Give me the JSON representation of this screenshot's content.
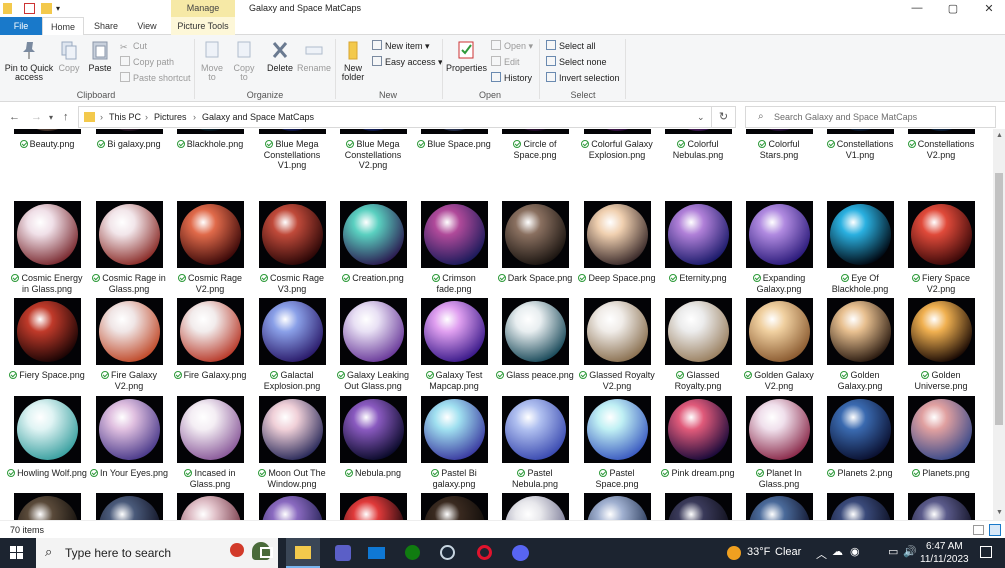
{
  "window": {
    "title": "Galaxy and Space MatCaps",
    "manage_tab": "Manage",
    "minimize": "—",
    "maximize": "▢",
    "close": "✕"
  },
  "ribbon_tabs": {
    "file": "File",
    "home": "Home",
    "share": "Share",
    "view": "View",
    "picture_tools": "Picture Tools"
  },
  "ribbon": {
    "pin_to_quick_access": "Pin to Quick access",
    "copy": "Copy",
    "paste": "Paste",
    "cut": "Cut",
    "copy_path": "Copy path",
    "paste_shortcut": "Paste shortcut",
    "move_to": "Move to",
    "copy_to": "Copy to",
    "delete": "Delete",
    "rename": "Rename",
    "new_folder": "New folder",
    "new_item": "New item",
    "easy_access": "Easy access",
    "properties": "Properties",
    "open": "Open",
    "edit": "Edit",
    "history": "History",
    "select_all": "Select all",
    "select_none": "Select none",
    "invert_selection": "Invert selection",
    "groups": {
      "clipboard": "Clipboard",
      "organize": "Organize",
      "new": "New",
      "open": "Open",
      "select": "Select"
    }
  },
  "address": {
    "root": "This PC",
    "sep": "›",
    "folder1": "Pictures",
    "folder2": "Galaxy and Space MatCaps"
  },
  "search": {
    "placeholder": "Search Galaxy and Space MatCaps"
  },
  "files": [
    {
      "name": "Beauty.png",
      "c1": "#c7b8b0",
      "c2": "#3a2a22"
    },
    {
      "name": "Bi galaxy.png",
      "c1": "#a8708a",
      "c2": "#1c0f1c"
    },
    {
      "name": "Blackhole.png",
      "c1": "#3aa0b0",
      "c2": "#04111a"
    },
    {
      "name": "Blue Mega Constellations V1.png",
      "c1": "#5b78d8",
      "c2": "#0b1040"
    },
    {
      "name": "Blue Mega Constellations V2.png",
      "c1": "#6a8be0",
      "c2": "#0a1244"
    },
    {
      "name": "Blue Space.png",
      "c1": "#a7b5d0",
      "c2": "#1d2540"
    },
    {
      "name": "Circle of Space.png",
      "c1": "#aa5aa0",
      "c2": "#1b0824"
    },
    {
      "name": "Colorful Galaxy Explosion.png",
      "c1": "#d884b4",
      "c2": "#2a0a3a"
    },
    {
      "name": "Colorful Nebulas.png",
      "c1": "#e07a8a",
      "c2": "#30104a"
    },
    {
      "name": "Colorful Stars.png",
      "c1": "#c05080",
      "c2": "#1a0a30"
    },
    {
      "name": "Constellations V1.png",
      "c1": "#3a6fa0",
      "c2": "#061226"
    },
    {
      "name": "Constellations V2.png",
      "c1": "#4a80a8",
      "c2": "#081830"
    },
    {
      "name": "Cosmic Energy in Glass.png",
      "c1": "#f0e0e8",
      "c2": "#7a2a30"
    },
    {
      "name": "Cosmic Rage in Glass.png",
      "c1": "#f2e6ea",
      "c2": "#8a2c28"
    },
    {
      "name": "Cosmic Rage V2.png",
      "c1": "#e06a4a",
      "c2": "#3a0808"
    },
    {
      "name": "Cosmic Rage V3.png",
      "c1": "#c04a3a",
      "c2": "#2a0606"
    },
    {
      "name": "Creation.png",
      "c1": "#5ad0c0",
      "c2": "#2a1a50"
    },
    {
      "name": "Crimson fade.png",
      "c1": "#b04a9a",
      "c2": "#1a1a5a"
    },
    {
      "name": "Dark Space.png",
      "c1": "#8a7060",
      "c2": "#1a1410"
    },
    {
      "name": "Deep Space.png",
      "c1": "#f0d0b0",
      "c2": "#3a2a2a"
    },
    {
      "name": "Eternity.png",
      "c1": "#b080d8",
      "c2": "#1a1a6a"
    },
    {
      "name": "Expanding Galaxy.png",
      "c1": "#b08ae0",
      "c2": "#2a1a7a"
    },
    {
      "name": "Eye Of Blackhole.png",
      "c1": "#2ab0e0",
      "c2": "#000812"
    },
    {
      "name": "Fiery Space V2.png",
      "c1": "#e04a3a",
      "c2": "#3a0808"
    },
    {
      "name": "Fiery Space.png",
      "c1": "#c03a2a",
      "c2": "#1a0404"
    },
    {
      "name": "Fire Galaxy V2.png",
      "c1": "#f0e6e6",
      "c2": "#c04a2a"
    },
    {
      "name": "Fire Galaxy.png",
      "c1": "#f2ecec",
      "c2": "#b83a2a"
    },
    {
      "name": "Galactal Explosion.png",
      "c1": "#8aa0e8",
      "c2": "#2a1a6a"
    },
    {
      "name": "Galaxy Leaking Out Glass.png",
      "c1": "#e8e0f4",
      "c2": "#6a3a9a"
    },
    {
      "name": "Galaxy Test Mapcap.png",
      "c1": "#e0a0f0",
      "c2": "#3a1a8a"
    },
    {
      "name": "Glass peace.png",
      "c1": "#e8eef0",
      "c2": "#1a4a5a"
    },
    {
      "name": "Glassed Royalty V2.png",
      "c1": "#f0ece8",
      "c2": "#8a7050"
    },
    {
      "name": "Glassed Royalty.png",
      "c1": "#ececec",
      "c2": "#9a8060"
    },
    {
      "name": "Golden Galaxy V2.png",
      "c1": "#f0d0a0",
      "c2": "#8a5a30"
    },
    {
      "name": "Golden Galaxy.png",
      "c1": "#e8c090",
      "c2": "#2a1a10"
    },
    {
      "name": "Golden Universe.png",
      "c1": "#f0b050",
      "c2": "#1a0a04"
    },
    {
      "name": "Howling Wolf.png",
      "c1": "#e0f4f4",
      "c2": "#3aa0a0"
    },
    {
      "name": "In Your Eyes.png",
      "c1": "#e0c0e0",
      "c2": "#4a3a8a"
    },
    {
      "name": "Incased in Glass.png",
      "c1": "#f4eef4",
      "c2": "#8a5a9a"
    },
    {
      "name": "Moon Out The Window.png",
      "c1": "#f0d0d8",
      "c2": "#2a2a5a"
    },
    {
      "name": "Nebula.png",
      "c1": "#8a5ac0",
      "c2": "#0a0a2a"
    },
    {
      "name": "Pastel Bi galaxy.png",
      "c1": "#a0e0f0",
      "c2": "#3a3aa0"
    },
    {
      "name": "Pastel Nebula.png",
      "c1": "#b0c0f0",
      "c2": "#3a4ab0"
    },
    {
      "name": "Pastel Space.png",
      "c1": "#c0f0f4",
      "c2": "#3a5ac0"
    },
    {
      "name": "Pink dream.png",
      "c1": "#e05a7a",
      "c2": "#1a0a3a"
    },
    {
      "name": "Planet In Glass.png",
      "c1": "#f0e0ec",
      "c2": "#8a2a4a"
    },
    {
      "name": "Planets 2.png",
      "c1": "#3a6ab0",
      "c2": "#0a1030"
    },
    {
      "name": "Planets.png",
      "c1": "#e0a0a0",
      "c2": "#3a4a8a"
    }
  ],
  "partial_row": [
    {
      "c1": "#5a4a3a",
      "c2": "#0a0806"
    },
    {
      "c1": "#4a5a7a",
      "c2": "#0a0a1a"
    },
    {
      "c1": "#e0c0c8",
      "c2": "#6a2a3a"
    },
    {
      "c1": "#8a6ac0",
      "c2": "#1a1a4a"
    },
    {
      "c1": "#e03a3a",
      "c2": "#0a0208"
    },
    {
      "c1": "#3a2a20",
      "c2": "#0a0806"
    },
    {
      "c1": "#e8e8ec",
      "c2": "#6a6a8a"
    },
    {
      "c1": "#a0b0d0",
      "c2": "#1a2a4a"
    },
    {
      "c1": "#3a3a5a",
      "c2": "#0a0a14"
    },
    {
      "c1": "#4a6a9a",
      "c2": "#0a0a20"
    },
    {
      "c1": "#3a4a7a",
      "c2": "#060818"
    },
    {
      "c1": "#5a5a8a",
      "c2": "#0a0a1a"
    }
  ],
  "status": {
    "items": "70 items"
  },
  "taskbar": {
    "search_placeholder": "Type here to search",
    "temperature": "33°F",
    "weather": "Clear",
    "time": "6:47 AM",
    "date": "11/11/2023"
  }
}
